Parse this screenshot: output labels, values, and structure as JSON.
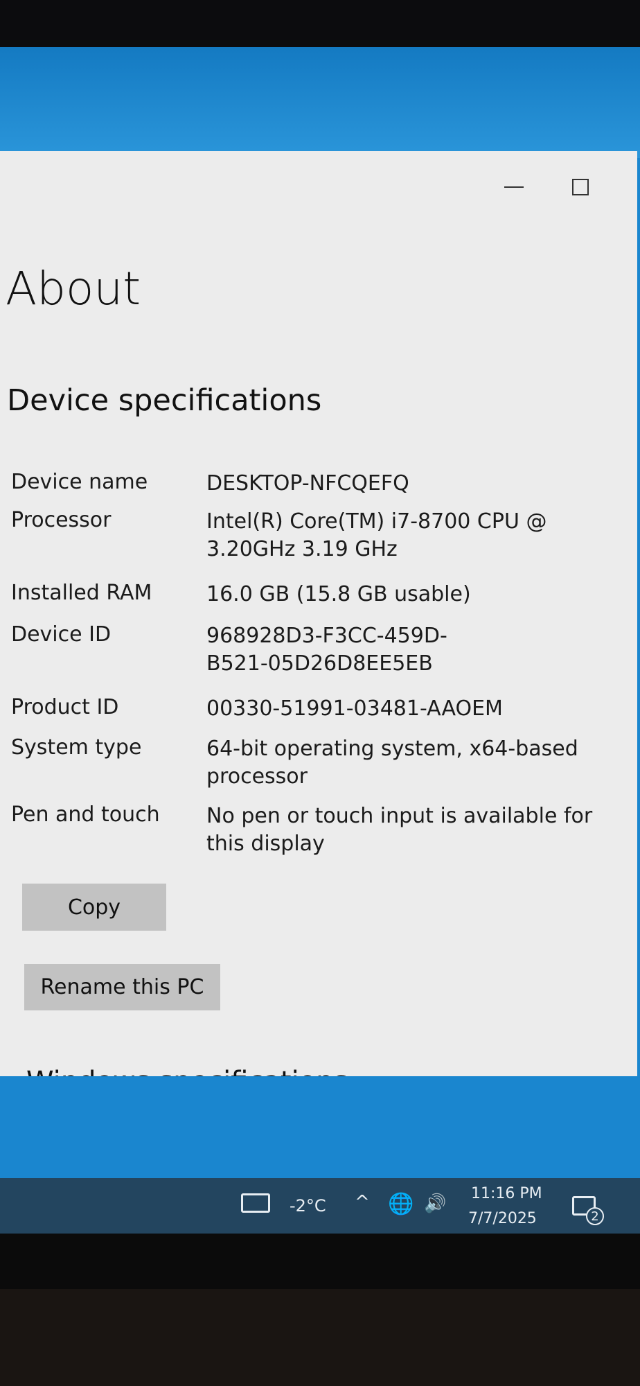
{
  "window": {
    "title": "About",
    "minimize_symbol": "",
    "maximize_symbol": ""
  },
  "device_specifications": {
    "heading": "Device specifications",
    "rows": [
      {
        "label": "Device name",
        "value": "DESKTOP-NFCQEFQ"
      },
      {
        "label": "Processor",
        "value": "Intel(R) Core(TM) i7-8700 CPU @ 3.20GHz   3.19 GHz"
      },
      {
        "label": "Installed RAM",
        "value": "16.0 GB (15.8 GB usable)"
      },
      {
        "label": "Device ID",
        "value": "968928D3-F3CC-459D-B521-05D26D8EE5EB"
      },
      {
        "label": "Product ID",
        "value": "00330-51991-03481-AAOEM"
      },
      {
        "label": "System type",
        "value": "64-bit operating system, x64-based processor"
      },
      {
        "label": "Pen and touch",
        "value": "No pen or touch input is available for this display"
      }
    ],
    "copy_button": "Copy",
    "rename_button": "Rename this PC"
  },
  "next_section_heading": "Windows specifications",
  "taskbar": {
    "temperature": "-2°C",
    "time": "11:16 PM",
    "date": "7/7/2025",
    "notification_count": "2"
  }
}
